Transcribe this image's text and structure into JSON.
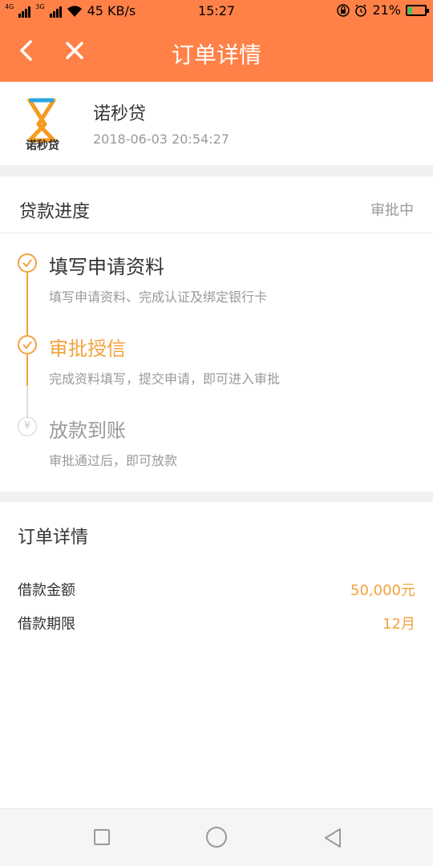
{
  "status_bar": {
    "net1": "4G",
    "net2": "3G",
    "speed": "45 KB/s",
    "time": "15:27",
    "battery": "21%",
    "battery_level": 0.21,
    "icons": [
      "signal-icon",
      "wifi-icon",
      "lock-icon",
      "alarm-icon",
      "battery-icon"
    ]
  },
  "header": {
    "title": "订单详情",
    "back_icon": "chevron-left-icon",
    "close_icon": "close-icon"
  },
  "merchant": {
    "logo_text": "诺秒贷",
    "name": "诺秒贷",
    "time": "2018-06-03 20:54:27"
  },
  "progress": {
    "title": "贷款进度",
    "status": "审批中",
    "steps": [
      {
        "title": "填写申请资料",
        "desc": "填写申请资料、完成认证及绑定银行卡",
        "state": "done",
        "title_color": "#333333",
        "icon": "check-icon"
      },
      {
        "title": "审批授信",
        "desc": "完成资料填写，提交申请，即可进入审批",
        "state": "current",
        "title_color": "#f3a23c",
        "icon": "check-icon"
      },
      {
        "title": "放款到账",
        "desc": "审批通过后，即可放款",
        "state": "pending",
        "title_color": "#999999",
        "icon": "yen-icon",
        "icon_glyph": "¥"
      }
    ]
  },
  "details": {
    "title": "订单详情",
    "rows": [
      {
        "label": "借款金额",
        "value": "50,000元"
      },
      {
        "label": "借款期限",
        "value": "12月"
      }
    ]
  },
  "colors": {
    "brand": "#ff8148",
    "accent": "#f3a23c"
  },
  "navbar": {
    "icons": [
      "recent-apps-icon",
      "home-icon",
      "back-triangle-icon"
    ]
  }
}
